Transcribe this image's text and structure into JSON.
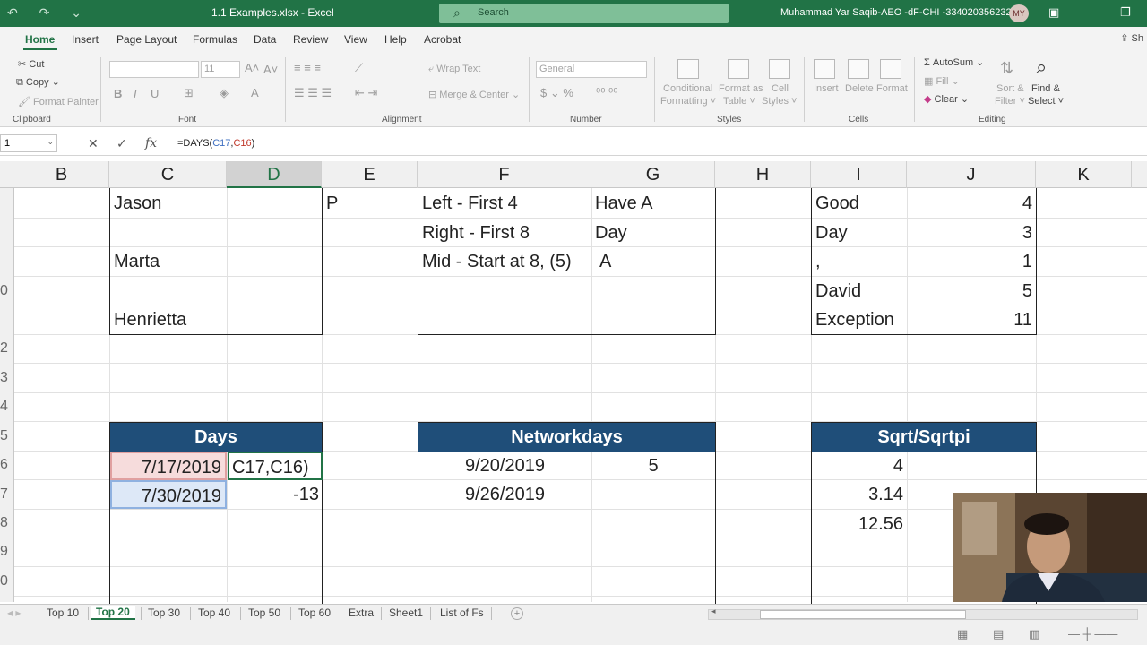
{
  "title_bar": {
    "document_title": "1.1 Examples.xlsx  -  Excel",
    "search_placeholder": "Search",
    "user_name": "Muhammad Yar Saqib-AEO -dF-CHI -3340203562321",
    "user_initials": "MY"
  },
  "ribbon_tabs": [
    "Home",
    "Insert",
    "Page Layout",
    "Formulas",
    "Data",
    "Review",
    "View",
    "Help",
    "Acrobat"
  ],
  "share_label": "Sh",
  "clipboard": {
    "cut": "Cut",
    "copy": "Copy",
    "format_painter": "Format Painter",
    "group": "Clipboard"
  },
  "font": {
    "size": "11",
    "group": "Font"
  },
  "alignment": {
    "wrap_text": "Wrap Text",
    "merge_center": "Merge & Center",
    "group": "Alignment"
  },
  "number": {
    "format": "General",
    "group": "Number"
  },
  "styles": {
    "conditional_formatting": [
      "Conditional",
      "Formatting ˅"
    ],
    "format_as_table": [
      "Format as",
      "Table ˅"
    ],
    "cell_styles": [
      "Cell",
      "Styles ˅"
    ],
    "group": "Styles"
  },
  "cells": {
    "insert": "Insert",
    "delete": "Delete",
    "format": "Format",
    "group": "Cells"
  },
  "editing": {
    "autosum": "AutoSum",
    "fill": "Fill",
    "clear": "Clear",
    "sort_filter": [
      "Sort &",
      "Filter ˅"
    ],
    "find_select": [
      "Find &",
      "Select ˅"
    ],
    "group": "Editing"
  },
  "formula_bar": {
    "name_box": "1",
    "formula_prefix": "=DAYS(",
    "formula_ref1": "C17",
    "formula_comma": ",",
    "formula_ref2": "C16",
    "formula_suffix": ")"
  },
  "columns": [
    "B",
    "C",
    "D",
    "E",
    "F",
    "G",
    "H",
    "I",
    "J",
    "K"
  ],
  "selected_column": "D",
  "row_numbers": [
    "",
    "",
    "",
    "0",
    "",
    "2",
    "3",
    "4",
    "5",
    "6",
    "7",
    "8",
    "9",
    "0"
  ],
  "names_table": [
    "Jason",
    "",
    "Marta",
    "",
    "Henrietta"
  ],
  "e_cell": "P",
  "text_functions": {
    "descriptions": [
      "Left - First 4",
      "Right - First 8",
      "Mid - Start at 8, (5)"
    ],
    "results": [
      "Have A",
      "Day",
      "A"
    ]
  },
  "word_counts": {
    "words": [
      "Good",
      "Day",
      ",",
      "David",
      "Exception"
    ],
    "counts": [
      "4",
      "3",
      "1",
      "5",
      "11"
    ]
  },
  "days_table": {
    "header": "Days",
    "date1": "7/17/2019",
    "editing_text": "C17,C16)",
    "date2": "7/30/2019",
    "result": "-13"
  },
  "networkdays_table": {
    "header": "Networkdays",
    "date1": "9/20/2019",
    "result": "5",
    "date2": "9/26/2019"
  },
  "sqrt_table": {
    "header": "Sqrt/Sqrtpi",
    "values": [
      "4",
      "3.14",
      "12.56"
    ]
  },
  "sheet_tabs": [
    "Top 10",
    "Top 20",
    "Top 30",
    "Top 40",
    "Top 50",
    "Top 60",
    "Extra",
    "Sheet1",
    "List of Fs"
  ],
  "active_sheet": "Top 20",
  "colors": {
    "excel_green": "#217346",
    "table_header": "#1f4e79",
    "ref1_blue": "#3e6fc1",
    "ref2_red": "#c0392b"
  }
}
